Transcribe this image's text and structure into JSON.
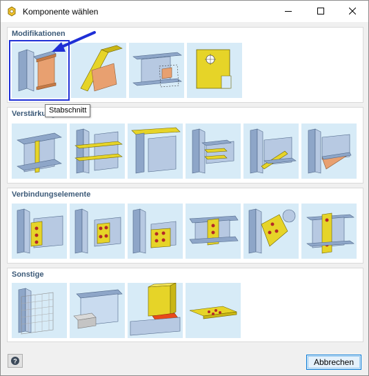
{
  "window": {
    "title": "Komponente wählen",
    "minimize_icon": "minimize-icon",
    "maximize_icon": "maximize-icon",
    "close_icon": "close-icon"
  },
  "sections": [
    {
      "title": "Modifikationen",
      "items": [
        "stabschnitt",
        "oblique-cut-plate",
        "member-end-cut",
        "plate-with-bolt"
      ]
    },
    {
      "title": "Verstärkungen",
      "items": [
        "web-stiffener",
        "flange-plates",
        "cap-plate",
        "column-stiffeners",
        "diagonal-stiffener",
        "haunch"
      ]
    },
    {
      "title": "Verbindungselemente",
      "items": [
        "fin-plate",
        "end-plate",
        "angle-cleat",
        "splice-plate",
        "gusset-plate",
        "base-plate"
      ]
    },
    {
      "title": "Sonstige",
      "items": [
        "mesh-plate",
        "concrete-block",
        "weld-block",
        "bolt-plate"
      ]
    }
  ],
  "tooltip": {
    "text": "Stabschnitt"
  },
  "footer": {
    "help_icon": "help-icon",
    "cancel_label": "Abbrechen"
  },
  "colors": {
    "accent": "#1f2fd6",
    "steel": "#8ea6c8",
    "plate_yellow": "#e6d428",
    "thumb_bg": "#d7ebf7"
  }
}
